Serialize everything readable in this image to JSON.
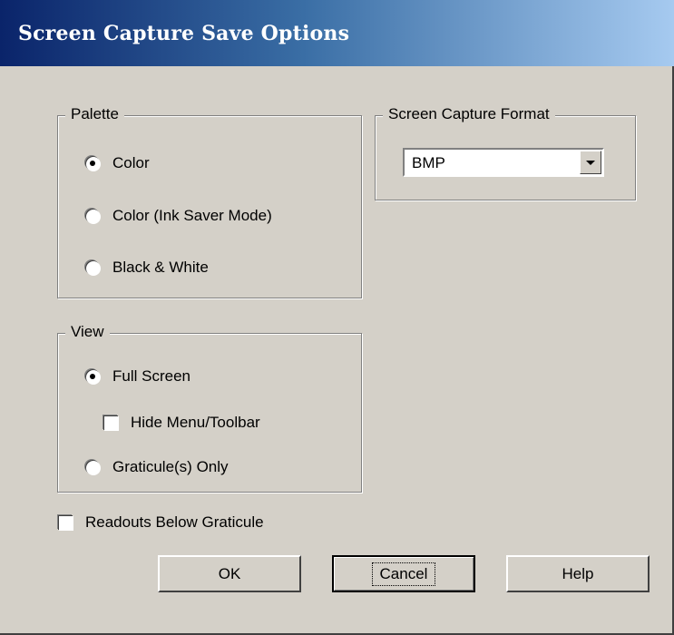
{
  "window": {
    "title": "Screen Capture Save Options"
  },
  "palette": {
    "label": "Palette",
    "options": [
      {
        "label": "Color",
        "checked": true
      },
      {
        "label": "Color (Ink Saver Mode)",
        "checked": false
      },
      {
        "label": "Black & White",
        "checked": false
      }
    ]
  },
  "format": {
    "label": "Screen Capture Format",
    "selected": "BMP"
  },
  "view": {
    "label": "View",
    "full_screen": {
      "label": "Full Screen",
      "checked": true
    },
    "hide_menu": {
      "label": "Hide Menu/Toolbar",
      "checked": false
    },
    "graticule_only": {
      "label": "Graticule(s) Only",
      "checked": false
    }
  },
  "readouts": {
    "label": "Readouts Below Graticule",
    "checked": false
  },
  "buttons": {
    "ok": "OK",
    "cancel": "Cancel",
    "help": "Help"
  }
}
